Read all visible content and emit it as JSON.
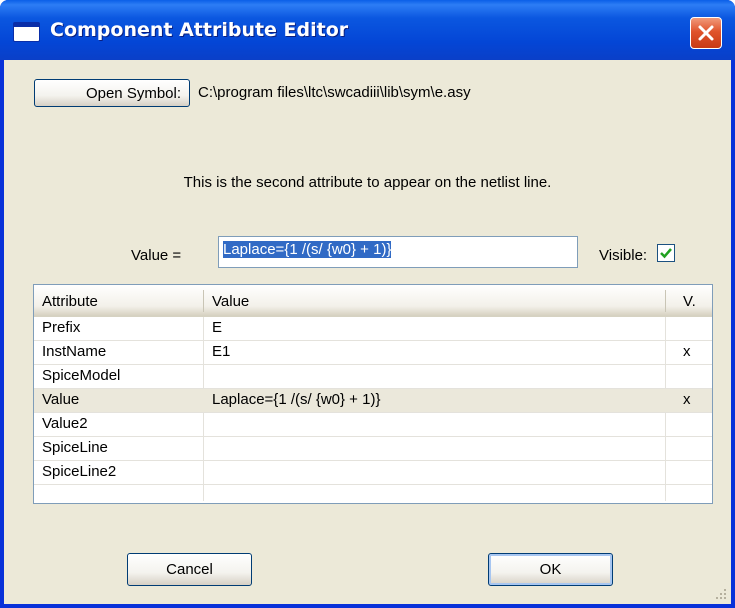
{
  "window": {
    "title": "Component Attribute Editor"
  },
  "symbol": {
    "open_button_label": "Open Symbol:",
    "path": "C:\\program files\\ltc\\swcadiii\\lib\\sym\\e.asy"
  },
  "description": "This is the second attribute to appear on the netlist line.",
  "value_field": {
    "label": "Value  =",
    "value": "Laplace={1 /(s/ {w0} + 1)}"
  },
  "visible": {
    "label": "Visible:",
    "checked": true
  },
  "table": {
    "headers": [
      "Attribute",
      "Value",
      "V."
    ],
    "rows": [
      {
        "attribute": "Prefix",
        "value": "E",
        "visible": ""
      },
      {
        "attribute": "InstName",
        "value": "E1",
        "visible": "x"
      },
      {
        "attribute": "SpiceModel",
        "value": "",
        "visible": ""
      },
      {
        "attribute": "Value",
        "value": "Laplace={1 /(s/ {w0} + 1)}",
        "visible": "x"
      },
      {
        "attribute": "Value2",
        "value": "",
        "visible": ""
      },
      {
        "attribute": "SpiceLine",
        "value": "",
        "visible": ""
      },
      {
        "attribute": "SpiceLine2",
        "value": "",
        "visible": ""
      }
    ],
    "selected_row": "Value"
  },
  "buttons": {
    "cancel": "Cancel",
    "ok": "OK"
  },
  "icons": {
    "title": "window-icon",
    "close": "close-icon",
    "check": "checkmark-icon",
    "grip": "resize-grip-icon"
  },
  "colors": {
    "titlebar": "#0446d6",
    "close_button": "#e0542c",
    "selection": "#316ac5",
    "checkmark": "#21a121"
  }
}
